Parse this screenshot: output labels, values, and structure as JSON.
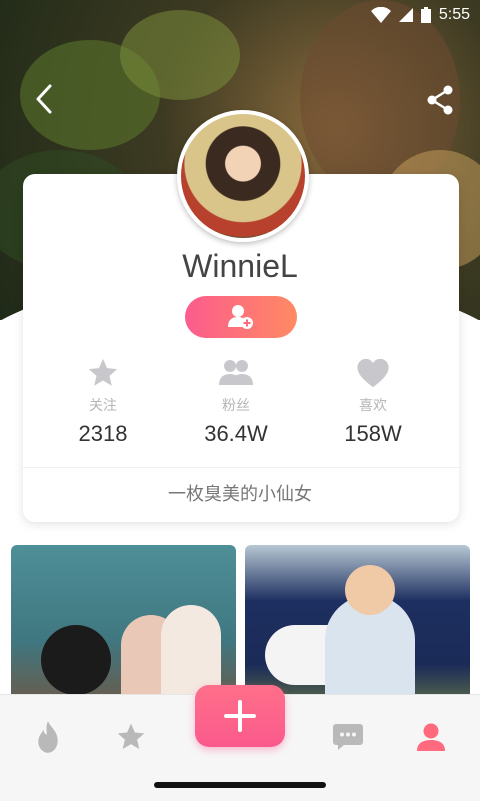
{
  "status": {
    "time": "5:55"
  },
  "profile": {
    "username": "WinnieL",
    "bio": "一枚臭美的小仙女",
    "stats": [
      {
        "label": "关注",
        "value": "2318",
        "icon": "star-icon"
      },
      {
        "label": "粉丝",
        "value": "36.4W",
        "icon": "fans-icon"
      },
      {
        "label": "喜欢",
        "value": "158W",
        "icon": "heart-icon"
      }
    ]
  },
  "tabs": [
    {
      "name": "hot",
      "icon": "flame-icon",
      "active": false
    },
    {
      "name": "favorites",
      "icon": "star-icon",
      "active": false
    },
    {
      "name": "messages",
      "icon": "chat-icon",
      "active": false
    },
    {
      "name": "me",
      "icon": "person-icon",
      "active": true
    }
  ],
  "colors": {
    "accent_start": "#fb5c8d",
    "accent_end": "#ff8a63",
    "tab_inactive": "#b9b9b9",
    "tab_active": "#ff6a7e"
  }
}
